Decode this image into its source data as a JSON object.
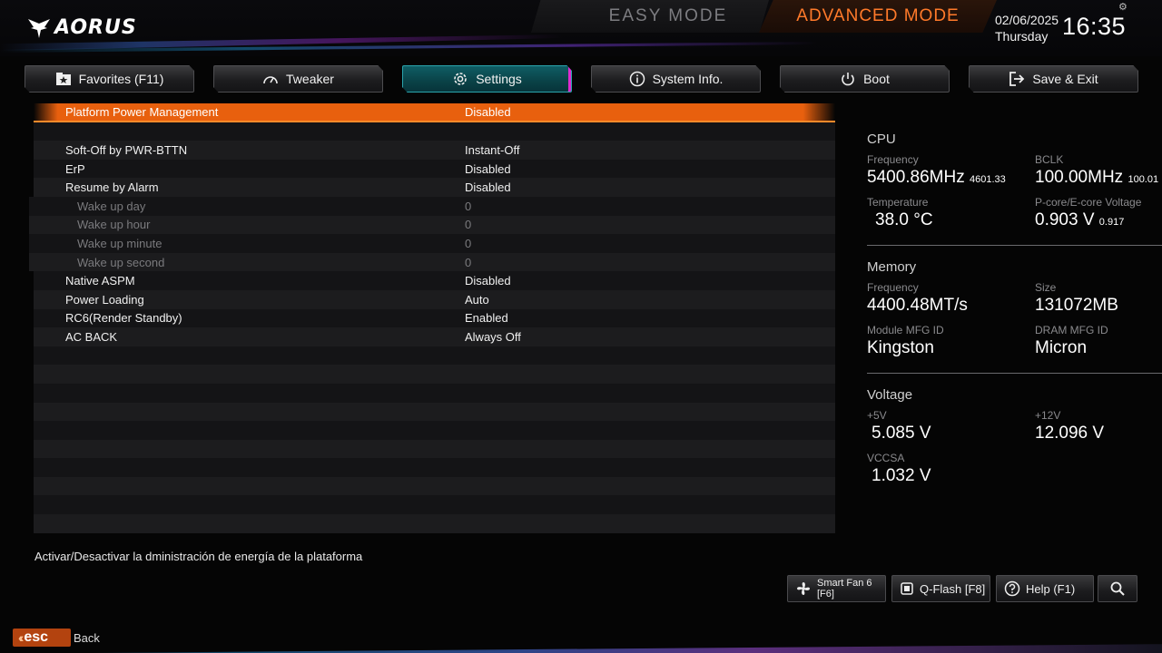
{
  "header": {
    "logo_text": "AORUS",
    "easy_mode_label": "EASY MODE",
    "advanced_mode_label": "ADVANCED MODE",
    "date": "02/06/2025",
    "day": "Thursday",
    "time": "16:35"
  },
  "tabs": [
    {
      "label": "Favorites (F11)",
      "icon": "star-folder-icon",
      "active": false
    },
    {
      "label": "Tweaker",
      "icon": "speedometer-icon",
      "active": false
    },
    {
      "label": "Settings",
      "icon": "gear-icon",
      "active": true
    },
    {
      "label": "System Info.",
      "icon": "info-icon",
      "active": false
    },
    {
      "label": "Boot",
      "icon": "power-icon",
      "active": false
    },
    {
      "label": "Save & Exit",
      "icon": "exit-icon",
      "active": false
    }
  ],
  "settings": {
    "highlighted": {
      "label": "Platform Power Management",
      "value": "Disabled"
    },
    "items": [
      {
        "label": "Soft-Off by PWR-BTTN",
        "value": "Instant-Off"
      },
      {
        "label": "ErP",
        "value": "Disabled"
      },
      {
        "label": "Resume by Alarm",
        "value": "Disabled"
      },
      {
        "label": "Wake up day",
        "value": "0"
      },
      {
        "label": "Wake up hour",
        "value": "0"
      },
      {
        "label": "Wake up minute",
        "value": "0"
      },
      {
        "label": "Wake up second",
        "value": "0"
      },
      {
        "label": "Native ASPM",
        "value": "Disabled"
      },
      {
        "label": "Power Loading",
        "value": "Auto"
      },
      {
        "label": "RC6(Render Standby)",
        "value": "Enabled"
      },
      {
        "label": "AC BACK",
        "value": "Always Off"
      }
    ]
  },
  "help_text": "Activar/Desactivar la dministración de energía de la plataforma",
  "panel": {
    "cpu": {
      "title": "CPU",
      "frequency_label": "Frequency",
      "frequency_value": "5400.86MHz",
      "frequency_sub": "4601.33",
      "bclk_label": "BCLK",
      "bclk_value": "100.00MHz",
      "bclk_sub": "100.01",
      "temperature_label": "Temperature",
      "temperature_value": "38.0 °C",
      "voltage_label": "P-core/E-core Voltage",
      "voltage_value": "0.903 V",
      "voltage_sub": "0.917"
    },
    "memory": {
      "title": "Memory",
      "frequency_label": "Frequency",
      "frequency_value": "4400.48MT/s",
      "size_label": "Size",
      "size_value": "131072MB",
      "module_label": "Module MFG ID",
      "module_value": "Kingston",
      "dram_label": "DRAM MFG ID",
      "dram_value": "Micron"
    },
    "voltage": {
      "title": "Voltage",
      "v5_label": "+5V",
      "v5_value": "5.085 V",
      "v12_label": "+12V",
      "v12_value": "12.096 V",
      "vccsa_label": "VCCSA",
      "vccsa_value": "1.032 V"
    }
  },
  "footer": {
    "smart_fan_label": "Smart Fan 6 [F6]",
    "qflash_label": "Q-Flash [F8]",
    "help_label": "Help (F1)",
    "esc_label": "esc",
    "back_label": "Back"
  },
  "colors": {
    "accent_orange": "#e8600e",
    "active_tab_teal": "#0a4247",
    "active_tab_magenta": "#e02ad0"
  }
}
